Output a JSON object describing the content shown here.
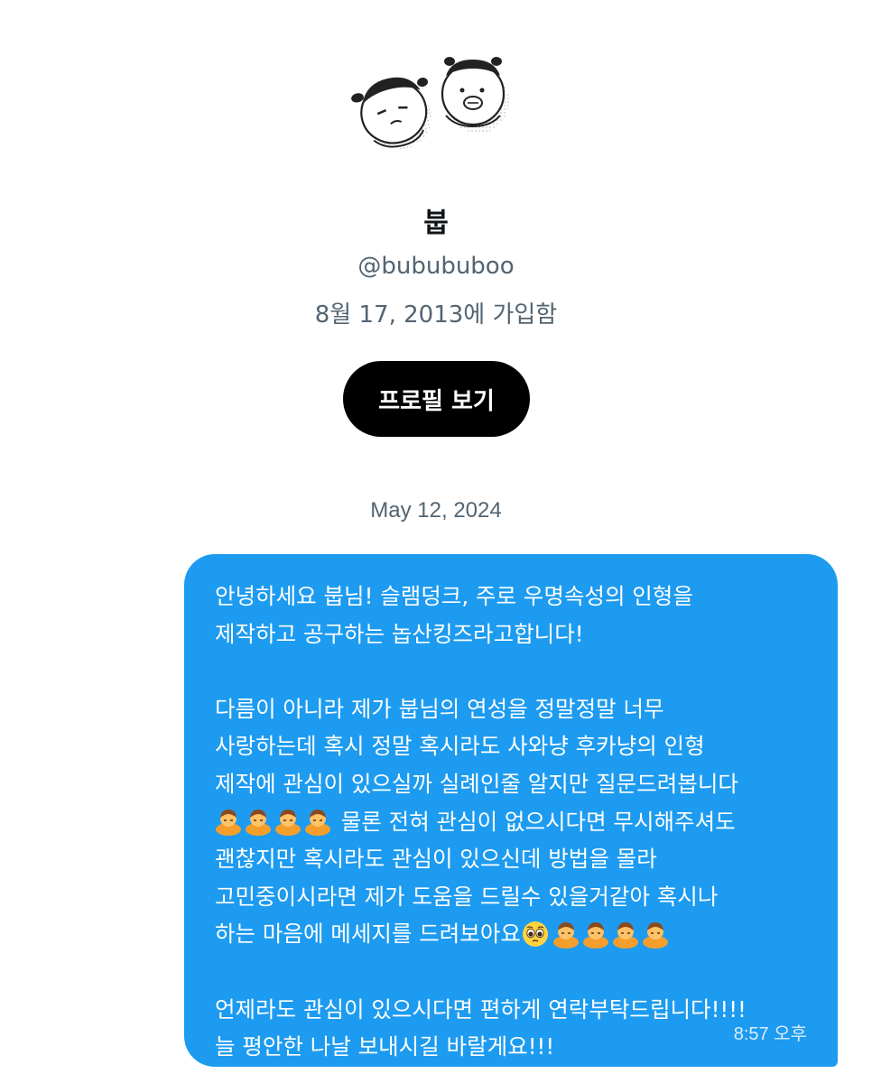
{
  "profile": {
    "display_name": "붑",
    "handle": "@bubububoo",
    "joined": "8월 17, 2013에 가입함",
    "view_profile_button": "프로필 보기"
  },
  "conversation": {
    "date_separator": "May 12, 2024",
    "message": {
      "lines": [
        "안녕하세요 붑님! 슬램덩크, 주로 우명속성의 인형을",
        "제작하고 공구하는 놉산킹즈라고합니다!",
        "",
        "다름이 아니라 제가 붑님의 연성을 정말정말 너무",
        "사랑하는데 혹시 정말 혹시라도 사와냥 후카냥의 인형",
        "제작에 관심이 있으실까 실례인줄 알지만 질문드려봅니다",
        " 물론 전혀 관심이 없으시다면 무시해주셔도",
        "괜찮지만 혹시라도 관심이 있으신데 방법을 몰라",
        "고민중이시라면 제가 도움을 드릴수 있을거같아 혹시나",
        "하는 마음에 메세지를 드려보아요",
        "",
        "언제라도 관심이 있으시다면 편하게 연락부탁드립니다!!!!",
        "늘 평안한 나날 보내시길 바랄게요!!!"
      ],
      "emoji": {
        "bowing": "person-bowing-emoji",
        "pleading": "pleading-face-emoji"
      },
      "timestamp": "8:57 오후"
    }
  },
  "colors": {
    "bubble": "#1d9bf0",
    "button": "#000000",
    "secondary_text": "#536471"
  }
}
